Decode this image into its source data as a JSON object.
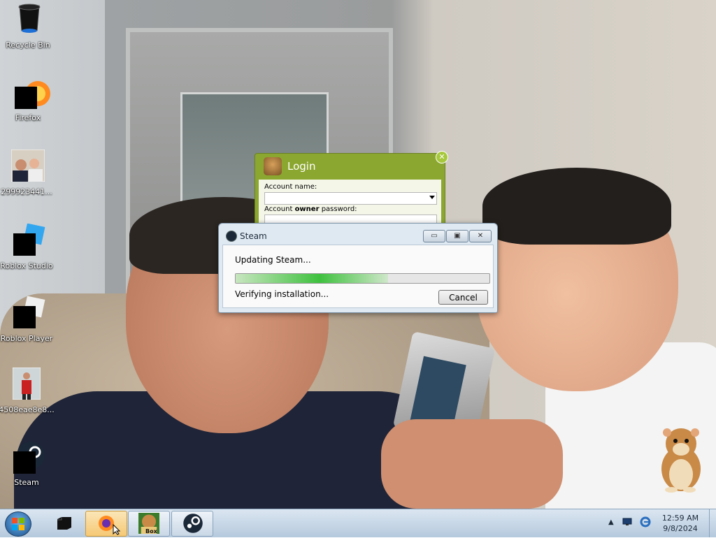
{
  "desktop": {
    "icons": [
      {
        "label": "Recycle Bin",
        "icon": "recycle-bin-icon"
      },
      {
        "label": "Firefox",
        "icon": "firefox-icon"
      },
      {
        "label": "299923441...",
        "icon": "photo-thumbnail-icon"
      },
      {
        "label": "Roblox Studio",
        "icon": "roblox-studio-icon"
      },
      {
        "label": "Roblox Player",
        "icon": "roblox-player-icon"
      },
      {
        "label": "4508eae8e8...",
        "icon": "photo-thumbnail-icon"
      },
      {
        "label": "Steam",
        "icon": "steam-icon"
      }
    ]
  },
  "login_window": {
    "title": "Login",
    "account_name_label": "Account name:",
    "password_label_prefix": "Account ",
    "password_label_bold": "owner",
    "password_label_suffix": " password:",
    "close_glyph": "✕"
  },
  "steam_dialog": {
    "title": "Steam",
    "status": "Updating Steam...",
    "progress": 0.6,
    "detail": "Verifying installation...",
    "cancel_label": "Cancel",
    "minimize_glyph": "▭",
    "maximize_glyph": "▣",
    "close_glyph": "✕"
  },
  "taskbar": {
    "buttons": [
      {
        "name": "file-manager-icon",
        "state": "normal"
      },
      {
        "name": "firefox-icon",
        "state": "active"
      },
      {
        "name": "box-app-icon",
        "state": "pinned",
        "label": "Box"
      },
      {
        "name": "steam-icon",
        "state": "pinned"
      }
    ],
    "tray": {
      "up_arrow": "▲",
      "time": "12:59 AM",
      "date": "9/8/2024"
    }
  },
  "colors": {
    "login_green": "#8ca730",
    "progress_green": "#3ec13e",
    "taskbar": "#c9d7e6"
  }
}
